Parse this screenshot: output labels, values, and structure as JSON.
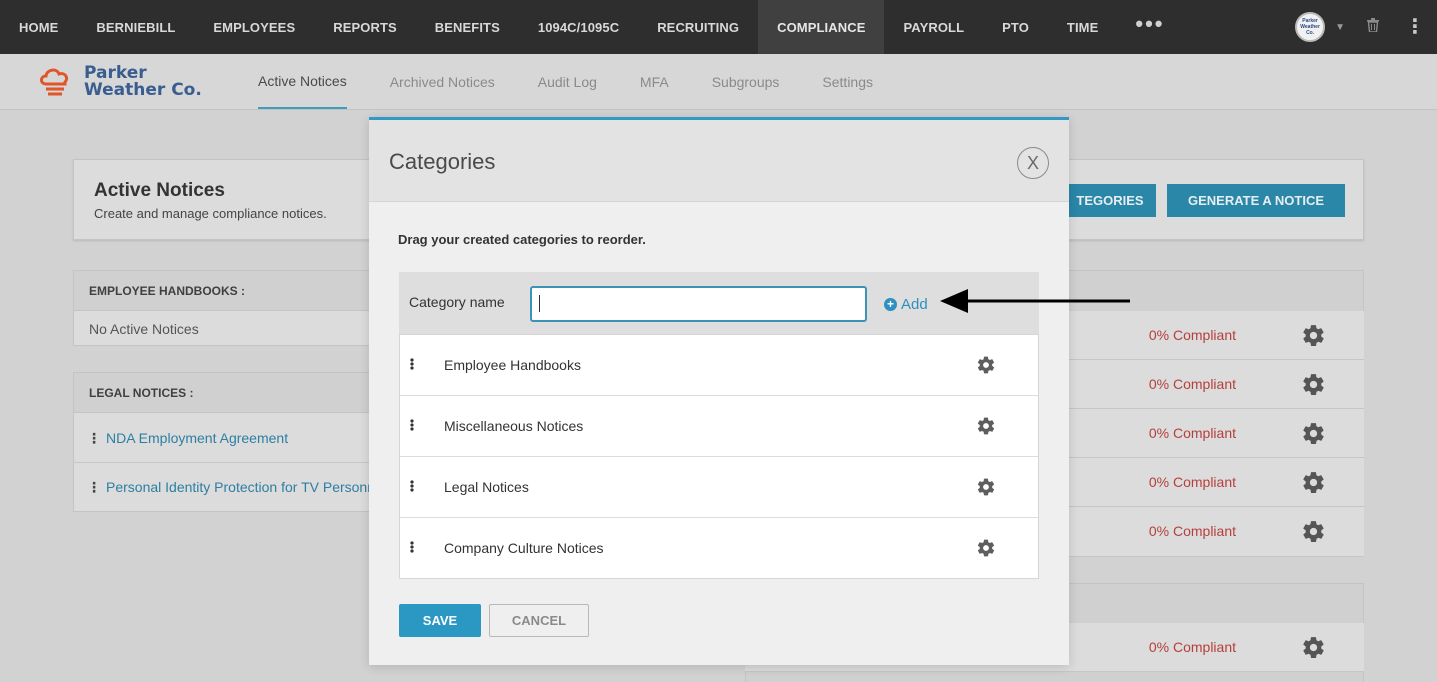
{
  "topnav": {
    "items": [
      "HOME",
      "BERNIEBILL",
      "EMPLOYEES",
      "REPORTS",
      "BENEFITS",
      "1094C/1095C",
      "RECRUITING",
      "COMPLIANCE",
      "PAYROLL",
      "PTO",
      "TIME"
    ],
    "active": "COMPLIANCE",
    "more_label": "•••",
    "avatar_text": "Parker Weather Co."
  },
  "brand": {
    "line1": "Parker",
    "line2": "Weather Co."
  },
  "subtabs": [
    "Active Notices",
    "Archived Notices",
    "Audit Log",
    "MFA",
    "Subgroups",
    "Settings"
  ],
  "page": {
    "title": "Active Notices",
    "subtitle": "Create and manage compliance notices.",
    "categories_button_partial": "TEGORIES",
    "generate_button": "GENERATE A NOTICE",
    "sections": [
      {
        "header": "EMPLOYEE HANDBOOKS :",
        "rows": [
          "No Active Notices"
        ]
      },
      {
        "header": "LEGAL NOTICES :",
        "rows": [
          "NDA Employment Agreement",
          "Personal Identity Protection for TV Personne"
        ]
      }
    ],
    "compliance_rows": [
      "0% Compliant",
      "0% Compliant",
      "0% Compliant",
      "0% Compliant",
      "0% Compliant",
      "0% Compliant"
    ]
  },
  "modal": {
    "title": "Categories",
    "close_label": "X",
    "instruction": "Drag your created categories to reorder.",
    "input_label": "Category name",
    "input_value": "",
    "add_label": "Add",
    "categories": [
      "Employee Handbooks",
      "Miscellaneous Notices",
      "Legal Notices",
      "Company Culture Notices"
    ],
    "save_label": "SAVE",
    "cancel_label": "CANCEL"
  },
  "colors": {
    "accent": "#3399c4",
    "nav_bg": "#2e2e2e",
    "compliance_red": "#b5403b"
  }
}
